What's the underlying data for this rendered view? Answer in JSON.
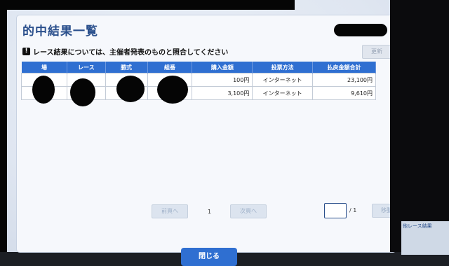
{
  "page": {
    "title": "的中結果一覧"
  },
  "notice": {
    "icon": "exclamation-icon",
    "text": "レース結果については、主催者発表のものと照合してください"
  },
  "toolbar": {
    "update_label": "更新"
  },
  "table": {
    "headers": [
      "場",
      "レース",
      "勝式",
      "組番",
      "購入金額",
      "投票方法",
      "払戻金額合計"
    ],
    "rows": [
      {
        "amount": "100円",
        "method": "インターネット",
        "payout": "23,100円"
      },
      {
        "amount": "3,100円",
        "method": "インターネット",
        "payout": "9,610円"
      }
    ]
  },
  "pagination": {
    "prev_label": "前頁へ",
    "current_page": "1",
    "next_label": "次頁へ",
    "total_label": "/ 1",
    "move_label": "移動"
  },
  "footer": {
    "close_label": "閉じる"
  },
  "side": {
    "link_text": "他レース結果"
  }
}
